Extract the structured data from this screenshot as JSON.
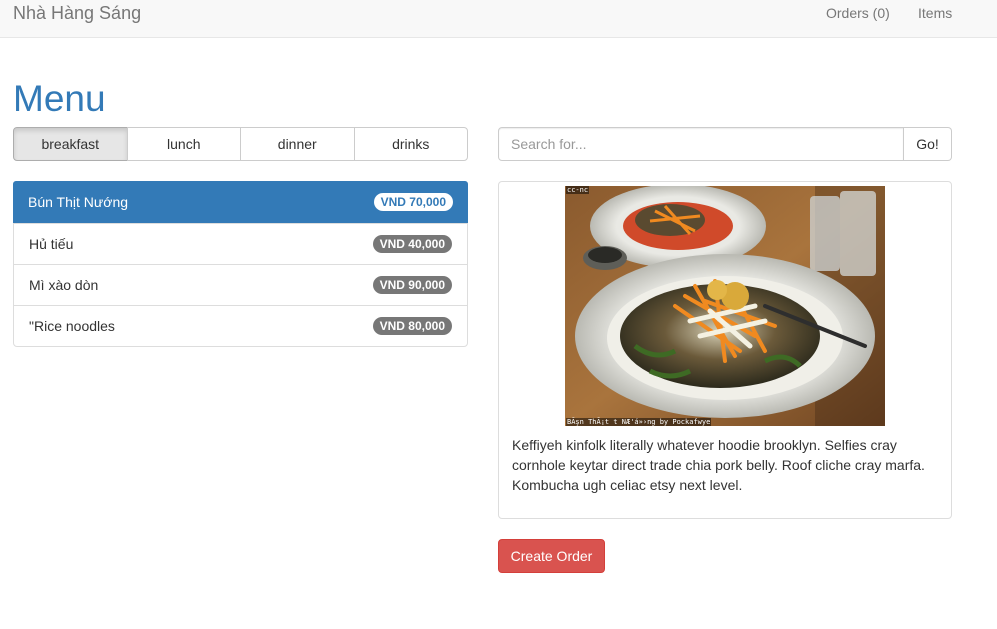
{
  "navbar": {
    "brand": "Nhà Hàng Sáng",
    "orders_label": "Orders (0)",
    "items_label": "Items"
  },
  "page": {
    "title": "Menu"
  },
  "categories": [
    {
      "label": "breakfast",
      "active": true
    },
    {
      "label": "lunch",
      "active": false
    },
    {
      "label": "dinner",
      "active": false
    },
    {
      "label": "drinks",
      "active": false
    }
  ],
  "menu_items": [
    {
      "name": "Bún Thịt Nướng",
      "price": "VND 70,000",
      "active": true
    },
    {
      "name": "Hủ tiếu",
      "price": "VND 40,000",
      "active": false
    },
    {
      "name": "Mì xào dòn",
      "price": "VND 90,000",
      "active": false
    },
    {
      "name": "\"Rice noodles",
      "price": "VND 80,000",
      "active": false
    }
  ],
  "search": {
    "placeholder": "Search for...",
    "button_label": "Go!"
  },
  "detail": {
    "image_tag_top": "cc-nc",
    "image_tag_bottom": "BÃşn ThÃ¡t t NÆ'á»›ng by Pockafwye",
    "description": "Keffiyeh kinfolk literally whatever hoodie brooklyn. Selfies cray cornhole keytar direct trade chia pork belly. Roof cliche cray marfa. Kombucha ugh celiac etsy next level."
  },
  "actions": {
    "create_order_label": "Create Order"
  },
  "colors": {
    "primary": "#337ab7",
    "danger": "#d9534f",
    "badge": "#777777",
    "navbar_bg": "#f8f8f8"
  }
}
